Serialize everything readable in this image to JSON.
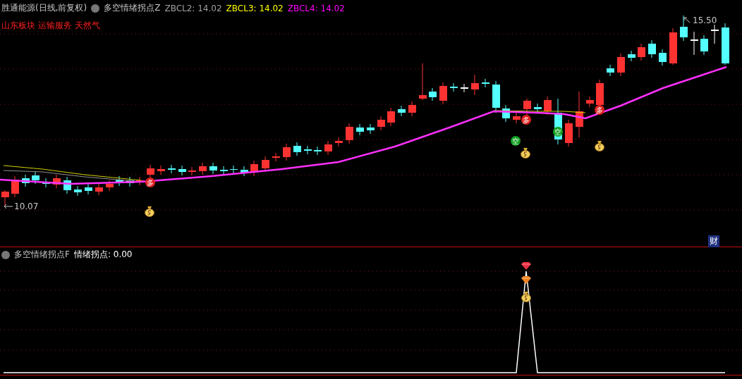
{
  "main_panel": {
    "stock_title": "胜通能源(日线,前复权)",
    "indicator_name": "多空情绪拐点Z",
    "indicator_values": [
      {
        "label": "ZBCL2: 14.02",
        "color": "#a0a0a0"
      },
      {
        "label": "ZBCL3: 14.02",
        "color": "#ffff00"
      },
      {
        "label": "ZBCL4: 14.02",
        "color": "#ff00ff"
      }
    ],
    "sectors": [
      "山东板块",
      "运输服务",
      "天然气"
    ],
    "high_label": "15.50",
    "low_label": "10.07",
    "markers": [
      {
        "kind": "long",
        "text": "多"
      },
      {
        "kind": "long",
        "text": "多"
      },
      {
        "kind": "long",
        "text": "多"
      },
      {
        "kind": "short",
        "text": "空"
      },
      {
        "kind": "short",
        "text": "空"
      }
    ],
    "finance_button": "财"
  },
  "sub_panel": {
    "indicator_name": "多空情绪拐点F",
    "reading_label": "情绪拐点: 0.00"
  }
}
